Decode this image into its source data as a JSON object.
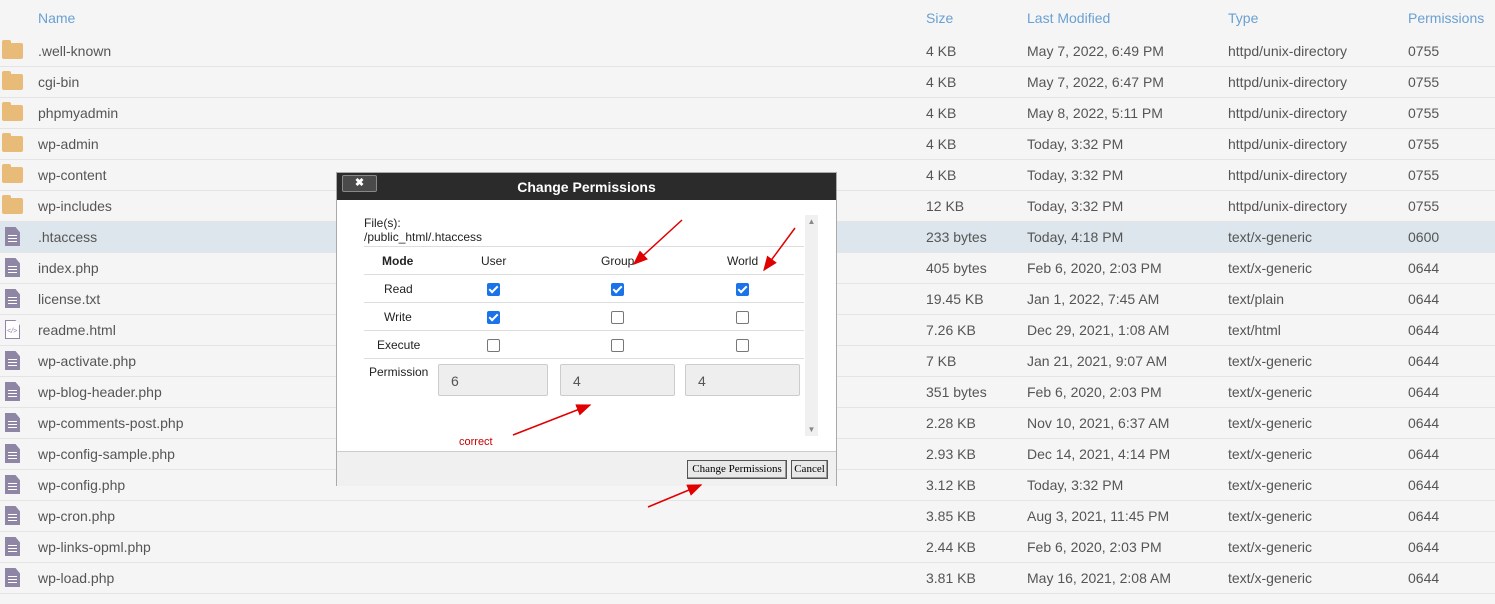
{
  "header": {
    "name": "Name",
    "size": "Size",
    "modified": "Last Modified",
    "type": "Type",
    "perms": "Permissions"
  },
  "files": [
    {
      "icon": "folder-icon",
      "name": ".well-known",
      "size": "4 KB",
      "modified": "May 7, 2022, 6:49 PM",
      "type": "httpd/unix-directory",
      "perms": "0755"
    },
    {
      "icon": "folder-icon",
      "name": "cgi-bin",
      "size": "4 KB",
      "modified": "May 7, 2022, 6:47 PM",
      "type": "httpd/unix-directory",
      "perms": "0755"
    },
    {
      "icon": "folder-icon",
      "name": "phpmyadmin",
      "size": "4 KB",
      "modified": "May 8, 2022, 5:11 PM",
      "type": "httpd/unix-directory",
      "perms": "0755"
    },
    {
      "icon": "folder-icon",
      "name": "wp-admin",
      "size": "4 KB",
      "modified": "Today, 3:32 PM",
      "type": "httpd/unix-directory",
      "perms": "0755"
    },
    {
      "icon": "folder-icon",
      "name": "wp-content",
      "size": "4 KB",
      "modified": "Today, 3:32 PM",
      "type": "httpd/unix-directory",
      "perms": "0755"
    },
    {
      "icon": "folder-icon",
      "name": "wp-includes",
      "size": "12 KB",
      "modified": "Today, 3:32 PM",
      "type": "httpd/unix-directory",
      "perms": "0755"
    },
    {
      "icon": "file-icon",
      "name": ".htaccess",
      "size": "233 bytes",
      "modified": "Today, 4:18 PM",
      "type": "text/x-generic",
      "perms": "0600",
      "selected": true
    },
    {
      "icon": "file-icon",
      "name": "index.php",
      "size": "405 bytes",
      "modified": "Feb 6, 2020, 2:03 PM",
      "type": "text/x-generic",
      "perms": "0644"
    },
    {
      "icon": "file-icon",
      "name": "license.txt",
      "size": "19.45 KB",
      "modified": "Jan 1, 2022, 7:45 AM",
      "type": "text/plain",
      "perms": "0644"
    },
    {
      "icon": "code-file-icon",
      "name": "readme.html",
      "size": "7.26 KB",
      "modified": "Dec 29, 2021, 1:08 AM",
      "type": "text/html",
      "perms": "0644"
    },
    {
      "icon": "file-icon",
      "name": "wp-activate.php",
      "size": "7 KB",
      "modified": "Jan 21, 2021, 9:07 AM",
      "type": "text/x-generic",
      "perms": "0644"
    },
    {
      "icon": "file-icon",
      "name": "wp-blog-header.php",
      "size": "351 bytes",
      "modified": "Feb 6, 2020, 2:03 PM",
      "type": "text/x-generic",
      "perms": "0644"
    },
    {
      "icon": "file-icon",
      "name": "wp-comments-post.php",
      "size": "2.28 KB",
      "modified": "Nov 10, 2021, 6:37 AM",
      "type": "text/x-generic",
      "perms": "0644"
    },
    {
      "icon": "file-icon",
      "name": "wp-config-sample.php",
      "size": "2.93 KB",
      "modified": "Dec 14, 2021, 4:14 PM",
      "type": "text/x-generic",
      "perms": "0644"
    },
    {
      "icon": "file-icon",
      "name": "wp-config.php",
      "size": "3.12 KB",
      "modified": "Today, 3:32 PM",
      "type": "text/x-generic",
      "perms": "0644"
    },
    {
      "icon": "file-icon",
      "name": "wp-cron.php",
      "size": "3.85 KB",
      "modified": "Aug 3, 2021, 11:45 PM",
      "type": "text/x-generic",
      "perms": "0644"
    },
    {
      "icon": "file-icon",
      "name": "wp-links-opml.php",
      "size": "2.44 KB",
      "modified": "Feb 6, 2020, 2:03 PM",
      "type": "text/x-generic",
      "perms": "0644"
    },
    {
      "icon": "file-icon",
      "name": "wp-load.php",
      "size": "3.81 KB",
      "modified": "May 16, 2021, 2:08 AM",
      "type": "text/x-generic",
      "perms": "0644"
    }
  ],
  "dialog": {
    "title": "Change Permissions",
    "close_label": "✖",
    "files_label": "File(s):",
    "file_path": "/public_html/.htaccess",
    "col_mode": "Mode",
    "col_user": "User",
    "col_group": "Group",
    "col_world": "World",
    "rows": [
      {
        "label": "Read",
        "user": true,
        "group": true,
        "world": true
      },
      {
        "label": "Write",
        "user": true,
        "group": false,
        "world": false
      },
      {
        "label": "Execute",
        "user": false,
        "group": false,
        "world": false
      }
    ],
    "permission_label": "Permission",
    "perm_user": "6",
    "perm_group": "4",
    "perm_world": "4",
    "annotation": "correct",
    "submit_label": "Change Permissions",
    "cancel_label": "Cancel"
  },
  "colors": {
    "accent": "#6aa0d3",
    "annotation": "#e00000",
    "title_bar": "#2b2b2b",
    "selected_row": "#dde6ec"
  }
}
